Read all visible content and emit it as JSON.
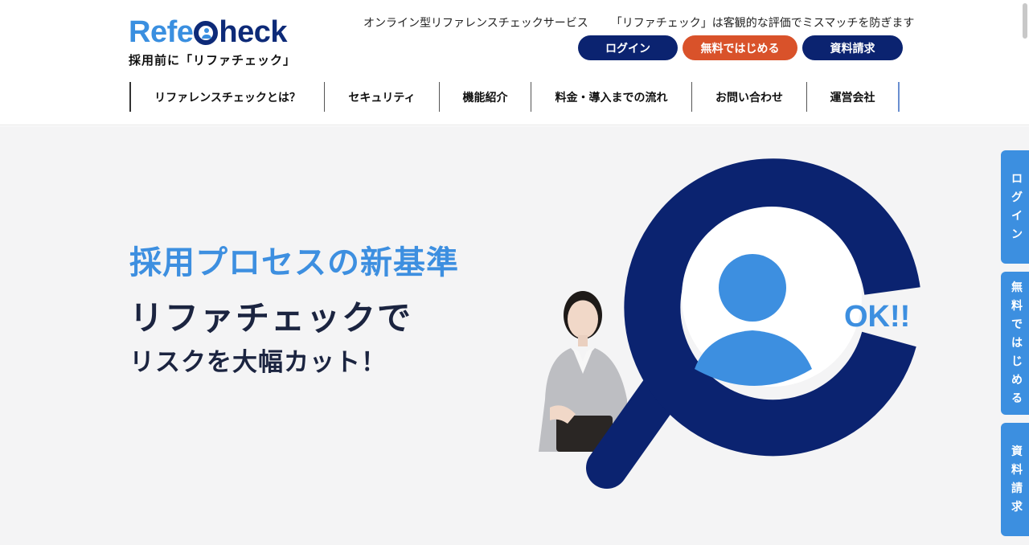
{
  "logo": {
    "part1": "Refe",
    "part2": "heck",
    "subtitle": "採用前に「リファチェック」"
  },
  "header": {
    "tagline_left": "オンライン型リファレンスチェックサービス",
    "tagline_right": "「リファチェック」は客観的な評価でミスマッチを防ぎます",
    "buttons": {
      "login": "ログイン",
      "free_start": "無料ではじめる",
      "docs": "資料請求"
    }
  },
  "nav": {
    "items": [
      "リファレンスチェックとは？",
      "セキュリティ",
      "機能紹介",
      "料金・導入までの流れ",
      "お問い合わせ",
      "運営会社"
    ]
  },
  "hero": {
    "title": "採用プロセスの新基準",
    "subtitle1": "リファチェックで",
    "subtitle2": "リスクを大幅カット！",
    "badge": "OK!!"
  },
  "side_tabs": {
    "login": "ログイン",
    "free_start": "無料ではじめる",
    "docs": "資料請求"
  },
  "colors": {
    "navy": "#0b2370",
    "accent_blue": "#3d8fe0",
    "orange": "#d9522a",
    "hero_bg": "#f4f4f5"
  }
}
